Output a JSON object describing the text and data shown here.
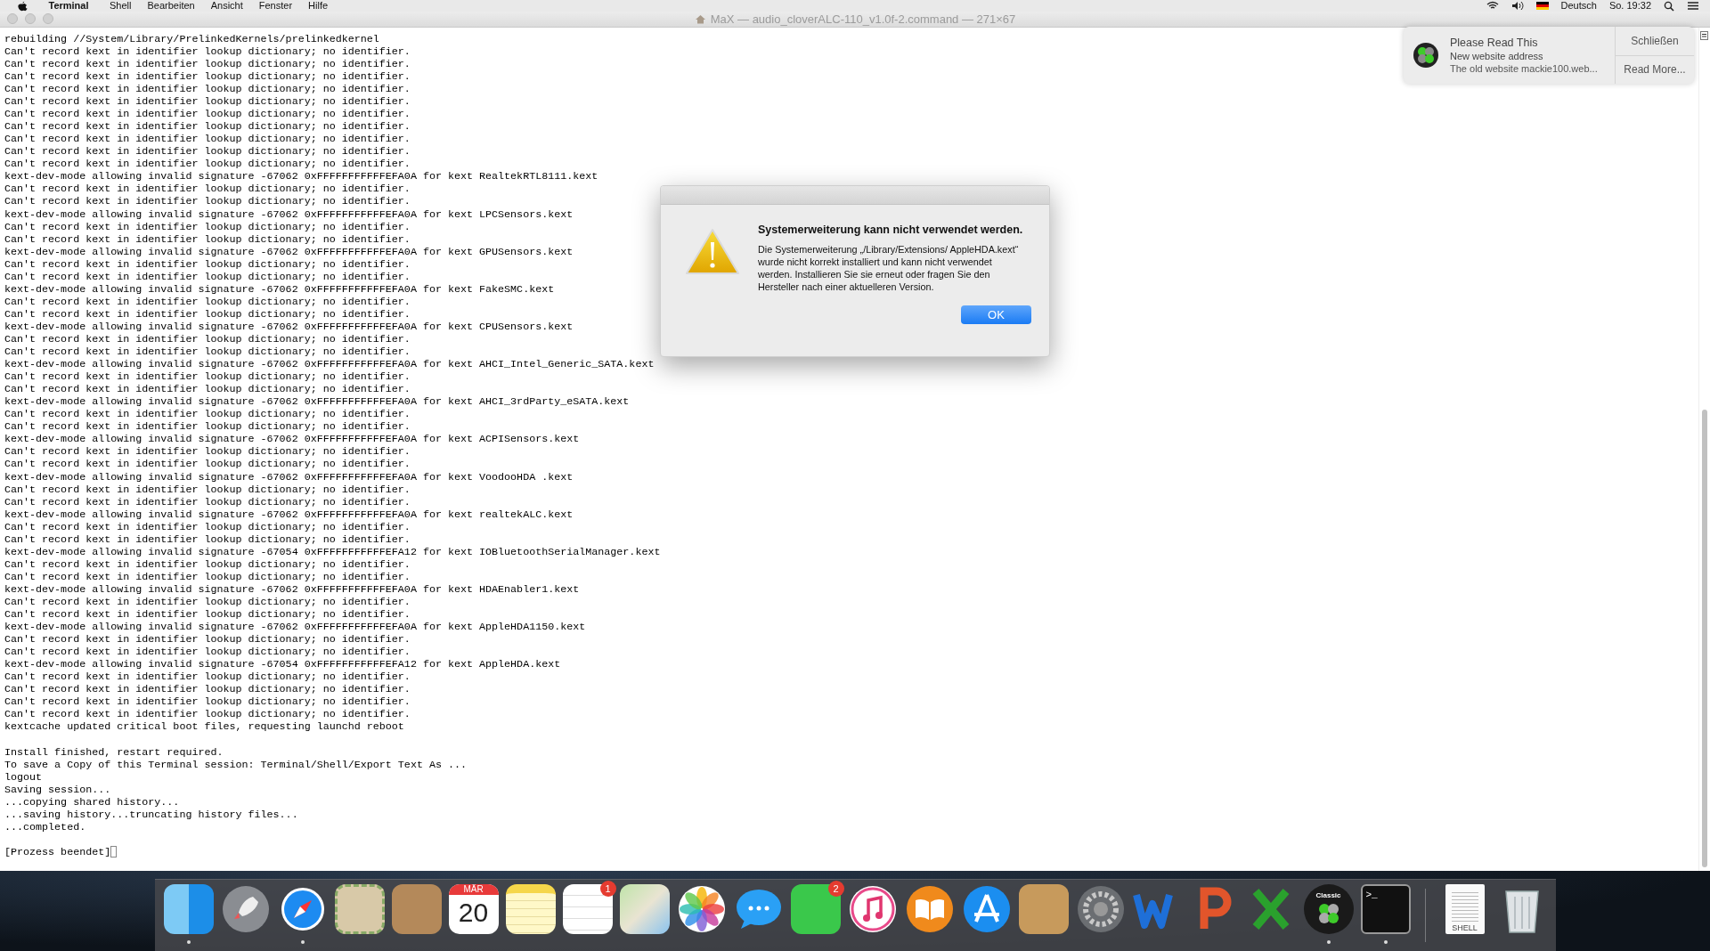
{
  "menu_bar": {
    "app": "Terminal",
    "menus": [
      "Shell",
      "Bearbeiten",
      "Ansicht",
      "Fenster",
      "Hilfe"
    ],
    "input_source": "Deutsch",
    "clock": "So. 19:32"
  },
  "window": {
    "title": "MaX — audio_cloverALC-110_v1.0f-2.command — 271×67"
  },
  "terminal": {
    "blocks": [
      [
        "rebuilding //System/Library/PrelinkedKernels/prelinkedkernel",
        "Can't record kext in identifier lookup dictionary; no identifier.",
        "Can't record kext in identifier lookup dictionary; no identifier.",
        "Can't record kext in identifier lookup dictionary; no identifier.",
        "Can't record kext in identifier lookup dictionary; no identifier.",
        "Can't record kext in identifier lookup dictionary; no identifier.",
        "Can't record kext in identifier lookup dictionary; no identifier.",
        "Can't record kext in identifier lookup dictionary; no identifier.",
        "Can't record kext in identifier lookup dictionary; no identifier.",
        "Can't record kext in identifier lookup dictionary; no identifier.",
        "Can't record kext in identifier lookup dictionary; no identifier.",
        "kext-dev-mode allowing invalid signature -67062 0xFFFFFFFFFFFEFA0A for kext RealtekRTL8111.kext",
        "Can't record kext in identifier lookup dictionary; no identifier.",
        "Can't record kext in identifier lookup dictionary; no identifier.",
        "kext-dev-mode allowing invalid signature -67062 0xFFFFFFFFFFFEFA0A for kext LPCSensors.kext",
        "Can't record kext in identifier lookup dictionary; no identifier.",
        "Can't record kext in identifier lookup dictionary; no identifier.",
        "kext-dev-mode allowing invalid signature -67062 0xFFFFFFFFFFFEFA0A for kext GPUSensors.kext",
        "Can't record kext in identifier lookup dictionary; no identifier.",
        "Can't record kext in identifier lookup dictionary; no identifier.",
        "kext-dev-mode allowing invalid signature -67062 0xFFFFFFFFFFFEFA0A for kext FakeSMC.kext",
        "Can't record kext in identifier lookup dictionary; no identifier.",
        "Can't record kext in identifier lookup dictionary; no identifier.",
        "kext-dev-mode allowing invalid signature -67062 0xFFFFFFFFFFFEFA0A for kext CPUSensors.kext",
        "Can't record kext in identifier lookup dictionary; no identifier.",
        "Can't record kext in identifier lookup dictionary; no identifier.",
        "kext-dev-mode allowing invalid signature -67062 0xFFFFFFFFFFFEFA0A for kext AHCI_Intel_Generic_SATA.kext",
        "Can't record kext in identifier lookup dictionary; no identifier.",
        "Can't record kext in identifier lookup dictionary; no identifier.",
        "kext-dev-mode allowing invalid signature -67062 0xFFFFFFFFFFFEFA0A for kext AHCI_3rdParty_eSATA.kext",
        "Can't record kext in identifier lookup dictionary; no identifier.",
        "Can't record kext in identifier lookup dictionary; no identifier.",
        "kext-dev-mode allowing invalid signature -67062 0xFFFFFFFFFFFEFA0A for kext ACPISensors.kext",
        "Can't record kext in identifier lookup dictionary; no identifier.",
        "Can't record kext in identifier lookup dictionary; no identifier.",
        "kext-dev-mode allowing invalid signature -67062 0xFFFFFFFFFFFEFA0A for kext VoodooHDA .kext",
        "Can't record kext in identifier lookup dictionary; no identifier.",
        "Can't record kext in identifier lookup dictionary; no identifier.",
        "kext-dev-mode allowing invalid signature -67062 0xFFFFFFFFFFFEFA0A for kext realtekALC.kext",
        "Can't record kext in identifier lookup dictionary; no identifier.",
        "Can't record kext in identifier lookup dictionary; no identifier.",
        "kext-dev-mode allowing invalid signature -67054 0xFFFFFFFFFFFEFA12 for kext IOBluetoothSerialManager.kext",
        "Can't record kext in identifier lookup dictionary; no identifier.",
        "Can't record kext in identifier lookup dictionary; no identifier.",
        "kext-dev-mode allowing invalid signature -67062 0xFFFFFFFFFFFEFA0A for kext HDAEnabler1.kext",
        "Can't record kext in identifier lookup dictionary; no identifier.",
        "Can't record kext in identifier lookup dictionary; no identifier.",
        "kext-dev-mode allowing invalid signature -67062 0xFFFFFFFFFFFEFA0A for kext AppleHDA1150.kext",
        "Can't record kext in identifier lookup dictionary; no identifier.",
        "Can't record kext in identifier lookup dictionary; no identifier.",
        "kext-dev-mode allowing invalid signature -67054 0xFFFFFFFFFFFEFA12 for kext AppleHDA.kext",
        "Can't record kext in identifier lookup dictionary; no identifier.",
        "Can't record kext in identifier lookup dictionary; no identifier.",
        "Can't record kext in identifier lookup dictionary; no identifier.",
        "Can't record kext in identifier lookup dictionary; no identifier.",
        "kextcache updated critical boot files, requesting launchd reboot"
      ],
      [
        "Install finished, restart required.",
        "To save a Copy of this Terminal session: Terminal/Shell/Export Text As ...",
        "logout",
        "Saving session...",
        "...copying shared history...",
        "...saving history...truncating history files...",
        "...completed."
      ],
      [
        "[Prozess beendet]"
      ]
    ]
  },
  "notification": {
    "title": "Please Read This",
    "subtitle": "New website address",
    "body": "The old website mackie100.web...",
    "buttons": [
      "Schließen",
      "Read More..."
    ]
  },
  "dialog": {
    "title": "Systemerweiterung kann nicht verwendet werden.",
    "message": "Die Systemerweiterung „/Library/Extensions/ AppleHDA.kext“ wurde nicht korrekt installiert und kann nicht verwendet werden. Installieren Sie sie erneut oder fragen Sie den Hersteller nach einer aktuelleren Version.",
    "button": "OK"
  },
  "dock": [
    {
      "kind": "finder",
      "running": true
    },
    {
      "kind": "launchpad",
      "running": false
    },
    {
      "kind": "safari",
      "running": true
    },
    {
      "kind": "mail",
      "running": false
    },
    {
      "kind": "contacts",
      "running": false
    },
    {
      "kind": "calendar",
      "running": false,
      "month": "MÄR",
      "day": "20"
    },
    {
      "kind": "notes",
      "running": false
    },
    {
      "kind": "reminders",
      "running": false,
      "badge": "1"
    },
    {
      "kind": "maps",
      "running": false
    },
    {
      "kind": "photos",
      "running": false
    },
    {
      "kind": "messages",
      "running": false
    },
    {
      "kind": "facetime",
      "running": false,
      "badge": "2"
    },
    {
      "kind": "itunes",
      "running": false
    },
    {
      "kind": "ibooks",
      "running": false
    },
    {
      "kind": "appstore",
      "running": false
    },
    {
      "kind": "archiver",
      "running": false
    },
    {
      "kind": "preferences",
      "running": false
    },
    {
      "kind": "word",
      "running": false
    },
    {
      "kind": "powerpoint",
      "running": false
    },
    {
      "kind": "excel",
      "running": false
    },
    {
      "kind": "clover",
      "running": true,
      "label": "Classic"
    },
    {
      "kind": "terminal",
      "running": true,
      "prompt": ">_"
    },
    {
      "kind": "separator"
    },
    {
      "kind": "document",
      "running": false,
      "label": "SHELL"
    },
    {
      "kind": "trash",
      "running": false
    }
  ]
}
